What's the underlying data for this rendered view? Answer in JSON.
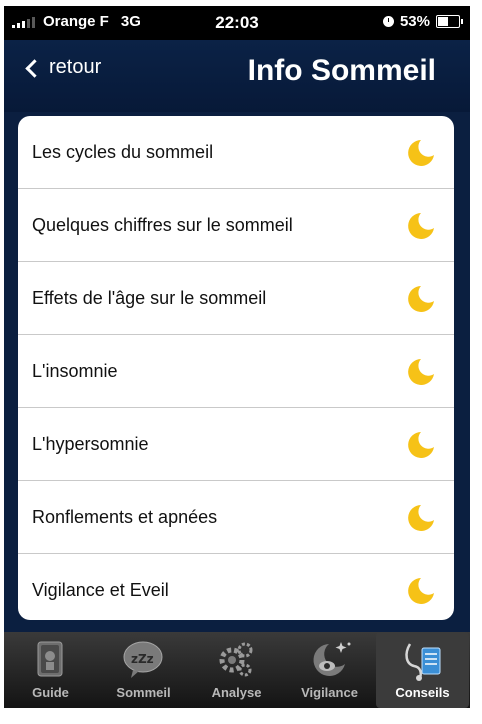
{
  "statusbar": {
    "carrier": "Orange F",
    "network": "3G",
    "time": "22:03",
    "battery": "53%"
  },
  "navbar": {
    "back_label": "retour",
    "title": "Info Sommeil"
  },
  "list": {
    "items": [
      {
        "label": "Les cycles du sommeil",
        "icon": "moon-icon"
      },
      {
        "label": "Quelques chiffres sur le sommeil",
        "icon": "moon-icon"
      },
      {
        "label": "Effets de l'âge sur le sommeil",
        "icon": "moon-icon"
      },
      {
        "label": "L'insomnie",
        "icon": "moon-icon"
      },
      {
        "label": "L'hypersomnie",
        "icon": "moon-icon"
      },
      {
        "label": "Ronflements et apnées",
        "icon": "moon-icon"
      },
      {
        "label": "Vigilance et Eveil",
        "icon": "moon-icon"
      }
    ]
  },
  "tabbar": {
    "tabs": [
      {
        "label": "Guide",
        "icon": "guide-book-icon"
      },
      {
        "label": "Sommeil",
        "icon": "zzz-bubble-icon"
      },
      {
        "label": "Analyse",
        "icon": "gears-icon"
      },
      {
        "label": "Vigilance",
        "icon": "eye-stars-icon"
      },
      {
        "label": "Conseils",
        "icon": "stethoscope-clipboard-icon",
        "active": true
      }
    ]
  },
  "colors": {
    "accent_moon": "#f6c217",
    "navbar_bg": "#0b2246",
    "tabbar_bg": "#1e1e1e"
  }
}
